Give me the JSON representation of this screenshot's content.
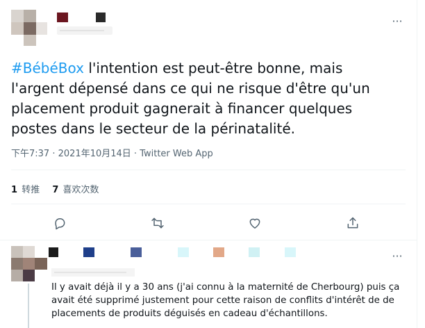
{
  "tweet": {
    "menu_glyph": "···",
    "hashtag": "#BébéBox",
    "body": " l'intention est peut-être bonne, mais l'argent dépensé dans ce qui ne risque d'être qu'un placement produit gagnerait à financer quelques postes dans le secteur de la périnatalité.",
    "time": "下午7:37",
    "separator": " · ",
    "date": "2021年10月14日",
    "source": "Twitter Web App",
    "retweets_count": "1",
    "retweets_label": "转推",
    "likes_count": "7",
    "likes_label": "喜欢次数",
    "icons": [
      "reply-icon",
      "retweet-icon",
      "like-icon",
      "share-icon"
    ],
    "colors": {
      "link": "#1d9bf0",
      "text": "#0f1419",
      "secondary": "#536471",
      "divider": "#eff3f4"
    }
  },
  "reply": {
    "menu_glyph": "···",
    "body": "Il y avait déjà il y a 30 ans (j'ai connu à la maternité de Cherbourg) puis ça avait été supprimé justement pour cette raison de conflits d'intérêt de de placements de produits déguisés en cadeau d'échantillons."
  }
}
